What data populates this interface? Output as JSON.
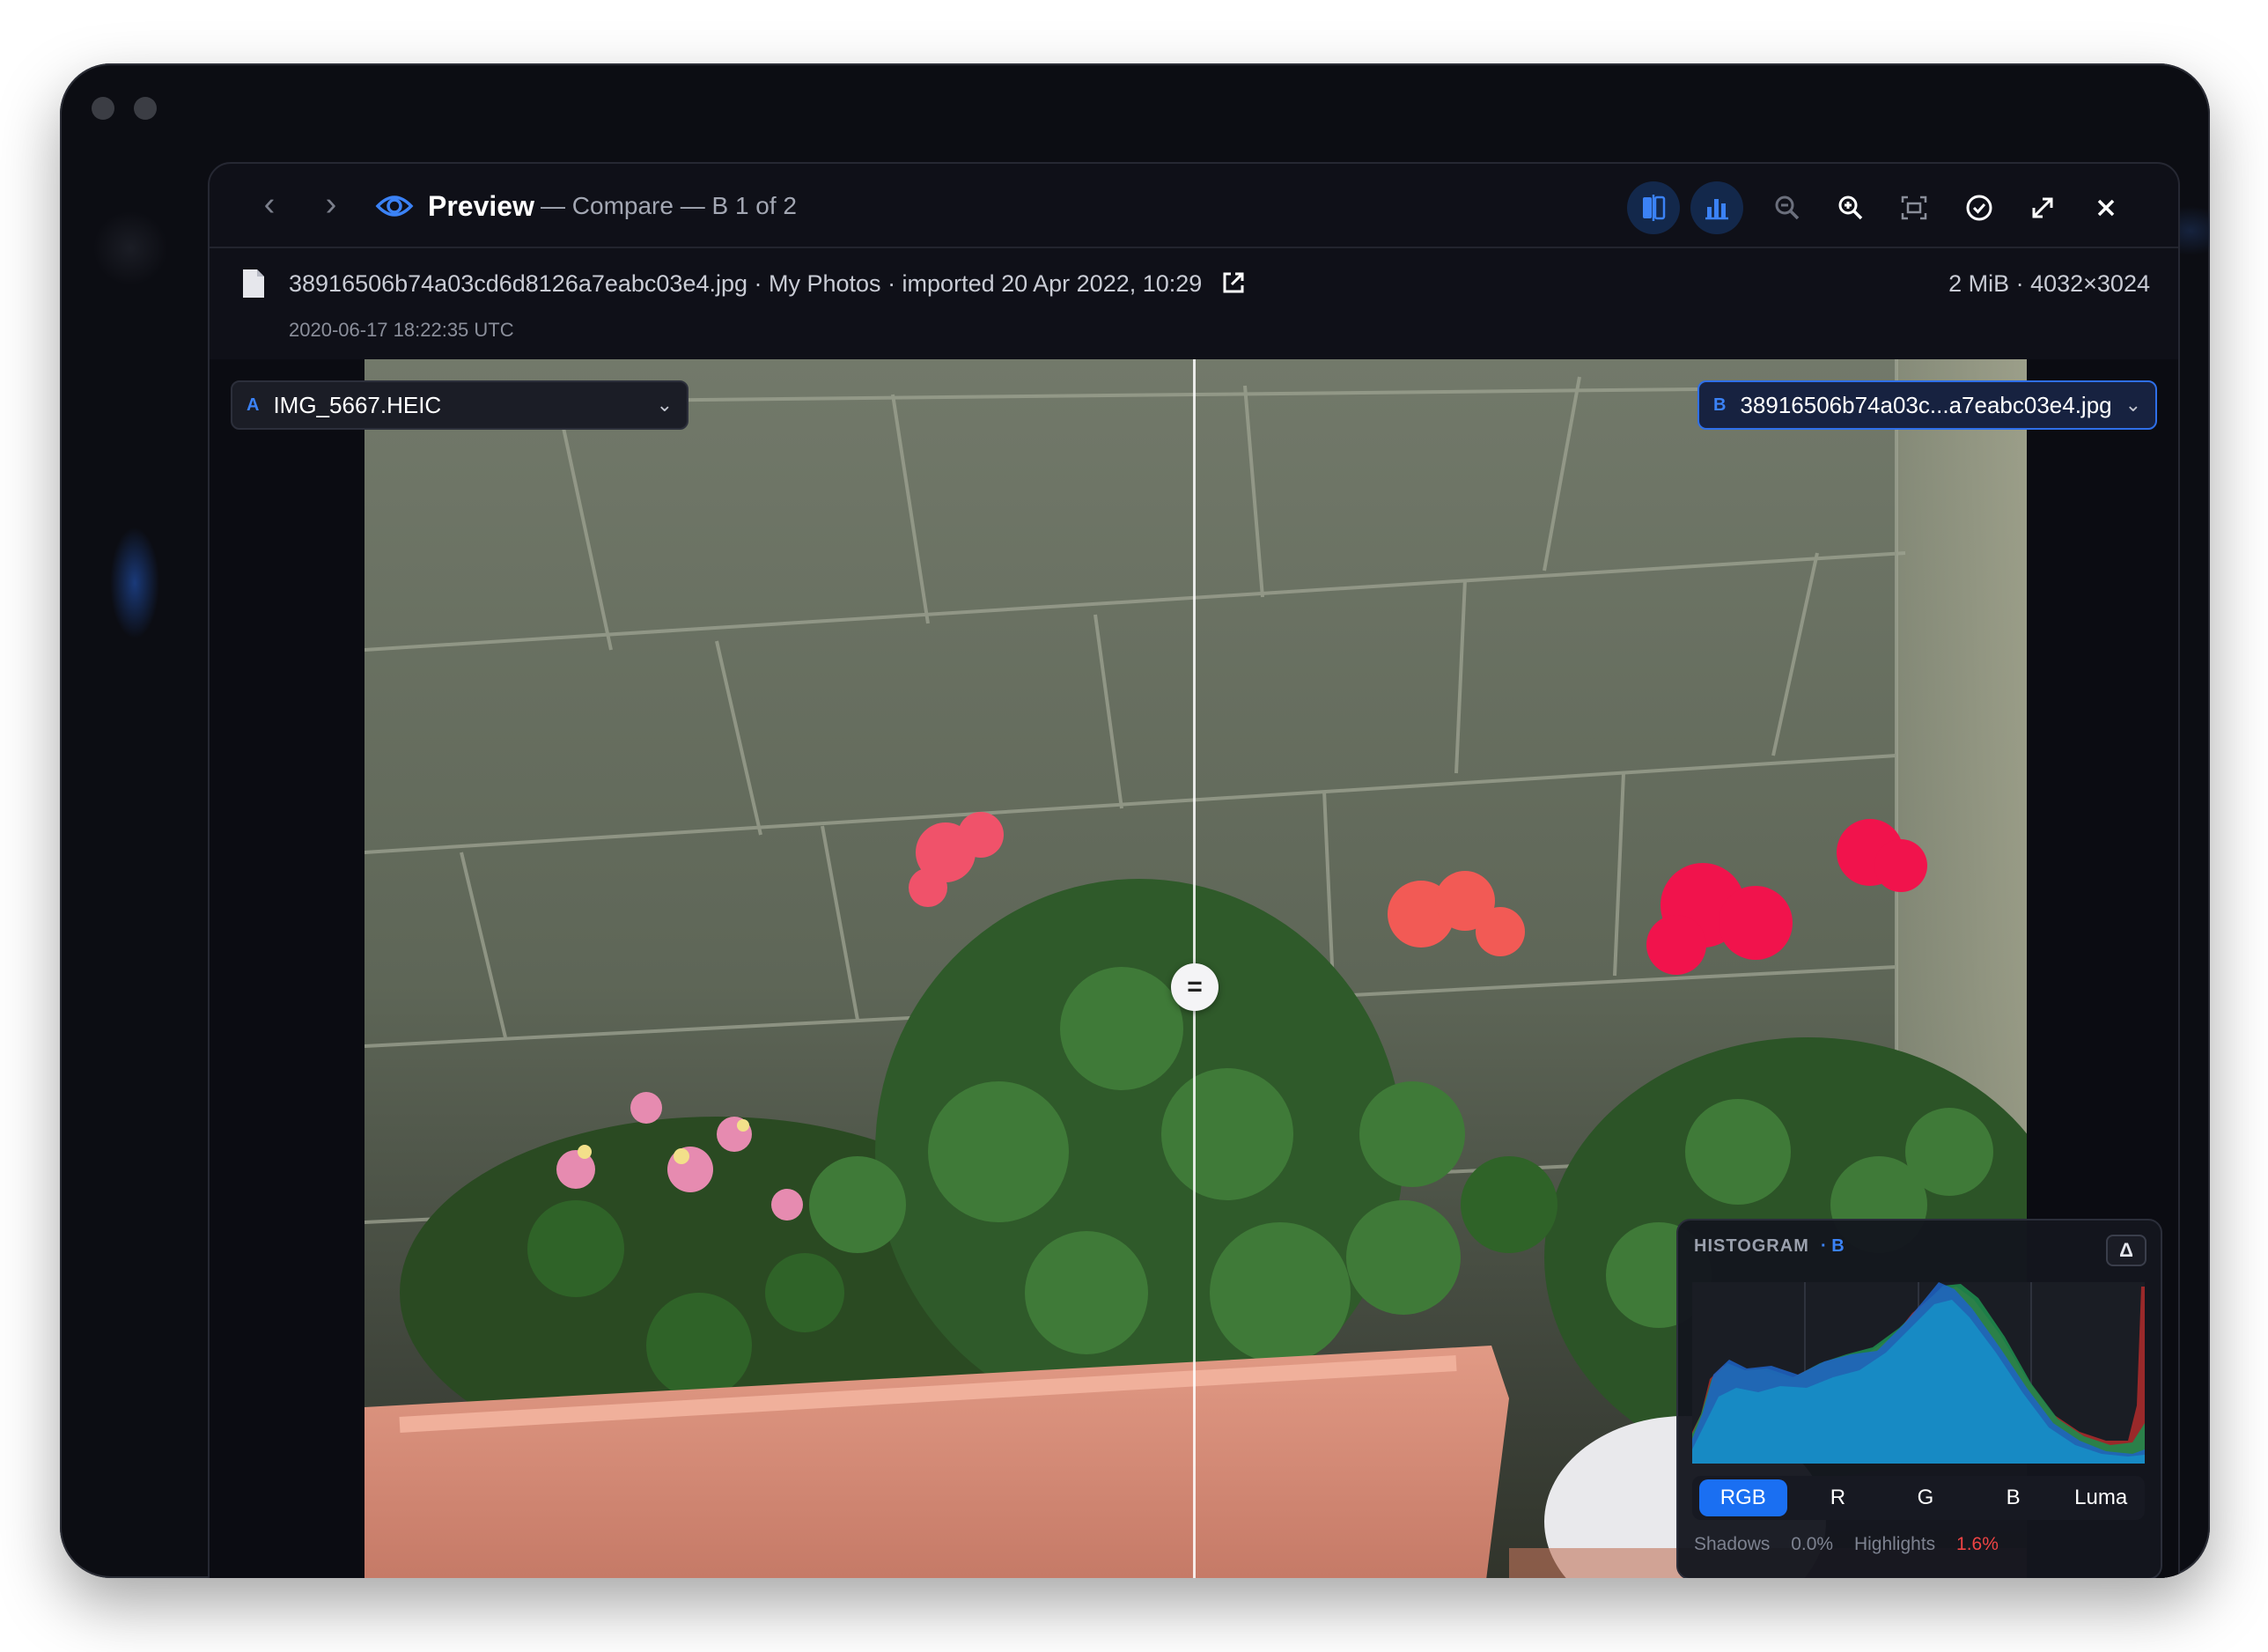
{
  "window": {
    "title": "Preview",
    "subtitle": "— Compare — B 1 of 2"
  },
  "toolbar": {
    "icons": [
      "chevron-left-icon",
      "chevron-right-icon",
      "eye-icon",
      "compare-icon",
      "histogram-icon",
      "zoom-out-icon",
      "zoom-in-icon",
      "fit-icon",
      "check-circle-icon",
      "expand-icon",
      "close-icon"
    ],
    "prev_label": "‹",
    "next_label": "›",
    "close_label": "✕"
  },
  "file": {
    "info": "38916506b74a03cd6d8126a7eabc03e4.jpg · My Photos · imported 20 Apr 2022, 10:29",
    "size": "2 MiB · 4032×3024",
    "taken": "2020-06-17 18:22:35 UTC"
  },
  "compare": {
    "a_tag": "A",
    "a_name": "IMG_5667.HEIC",
    "b_tag": "B",
    "b_name": "38916506b74a03c...a7eabc03e4.jpg",
    "chevron": "⌄",
    "handle": "="
  },
  "histogram": {
    "title": "HISTOGRAM",
    "channel_tag": "· B",
    "delta": "Δ",
    "channels": [
      "RGB",
      "R",
      "G",
      "B",
      "Luma"
    ],
    "selected_channel": "RGB",
    "shadows_label": "Shadows",
    "shadows_value": "0.0%",
    "highlights_label": "Highlights",
    "highlights_value": "1.6%"
  },
  "colors": {
    "accent": "#1a6ff2",
    "background": "#0f1018",
    "highlight_warning": "#ef4444"
  }
}
